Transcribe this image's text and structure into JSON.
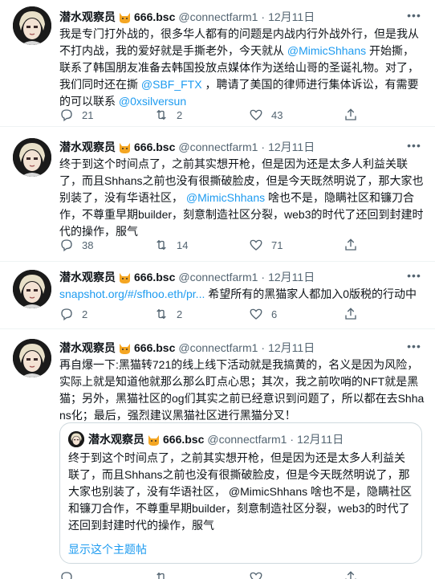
{
  "tweets": [
    {
      "display_name": "潜水观察员",
      "tag": "666.bsc",
      "handle": "@connectfarm1",
      "dot": "·",
      "date": "12月11日",
      "text_parts": [
        {
          "t": "我是专门打外战的，很多华人都有的问题是内战内行外战外行，但是我从不打内战，我的爱好就是手撕老外，今天就从 ",
          "link": false
        },
        {
          "t": "@MimicShhans",
          "link": true
        },
        {
          "t": " 开始撕，联系了韩国朋友准备去韩国投放点媒体作为送给山哥的圣诞礼物。对了，我们同时还在撕 ",
          "link": false
        },
        {
          "t": "@SBF_FTX",
          "link": true
        },
        {
          "t": " ，聘请了美国的律师进行集体诉讼，有需要的可以联系 ",
          "link": false
        },
        {
          "t": "@0xsilversun",
          "link": true
        }
      ],
      "replies": "21",
      "retweets": "2",
      "likes": "43"
    },
    {
      "display_name": "潜水观察员",
      "tag": "666.bsc",
      "handle": "@connectfarm1",
      "dot": "·",
      "date": "12月11日",
      "text_parts": [
        {
          "t": "终于到这个时间点了，之前其实想开枪，但是因为还是太多人利益关联了，而且Shhans之前也没有很撕破脸皮，但是今天既然明说了，那大家也别装了，没有华语社区， ",
          "link": false
        },
        {
          "t": "@MimicShhans",
          "link": true
        },
        {
          "t": " 啥也不是，隐瞒社区和镰刀合作，不尊重早期builder，刻意制造社区分裂，web3的时代了还回到封建时代的操作，服气",
          "link": false
        }
      ],
      "replies": "38",
      "retweets": "14",
      "likes": "71"
    },
    {
      "display_name": "潜水观察员",
      "tag": "666.bsc",
      "handle": "@connectfarm1",
      "dot": "·",
      "date": "12月11日",
      "text_parts": [
        {
          "t": "snapshot.org/#/sfhoo.eth/pr...",
          "link": true
        },
        {
          "t": " 希望所有的黑猫家人都加入0版税的行动中",
          "link": false
        }
      ],
      "replies": "2",
      "retweets": "2",
      "likes": "6"
    },
    {
      "display_name": "潜水观察员",
      "tag": "666.bsc",
      "handle": "@connectfarm1",
      "dot": "·",
      "date": "12月11日",
      "text_parts": [
        {
          "t": "再自爆一下:黑猫转721的线上线下活动就是我搞黄的，名义是因为风险，实际上就是知道他就那么那么盯点心思；其次，我之前吹哨的NFT就是黑猫；另外，黑猫社区的og们其实之前已经意识到问题了，所以都在去Shhans化；最后，强烈建议黑猫社区进行黑猫分叉！",
          "link": false
        }
      ],
      "quote": {
        "display_name": "潜水观察员",
        "tag": "666.bsc",
        "handle": "@connectfarm1",
        "dot": "·",
        "date": "12月11日",
        "text": "终于到这个时间点了，之前其实想开枪，但是因为还是太多人利益关联了，而且Shhans之前也没有很撕破脸皮，但是今天既然明说了，那大家也别装了，没有华语社区， @MimicShhans 啥也不是，隐瞒社区和镰刀合作，不尊重早期builder，刻意制造社区分裂，web3的时代了还回到封建时代的操作，服气",
        "show_thread": "显示这个主题帖"
      }
    }
  ],
  "icons": {
    "reply": "reply-icon",
    "retweet": "retweet-icon",
    "like": "heart-icon",
    "share": "share-icon",
    "more": "more-icon"
  },
  "colors": {
    "link": "#1d9bf0",
    "muted": "#536471",
    "border": "#eff3f4"
  }
}
